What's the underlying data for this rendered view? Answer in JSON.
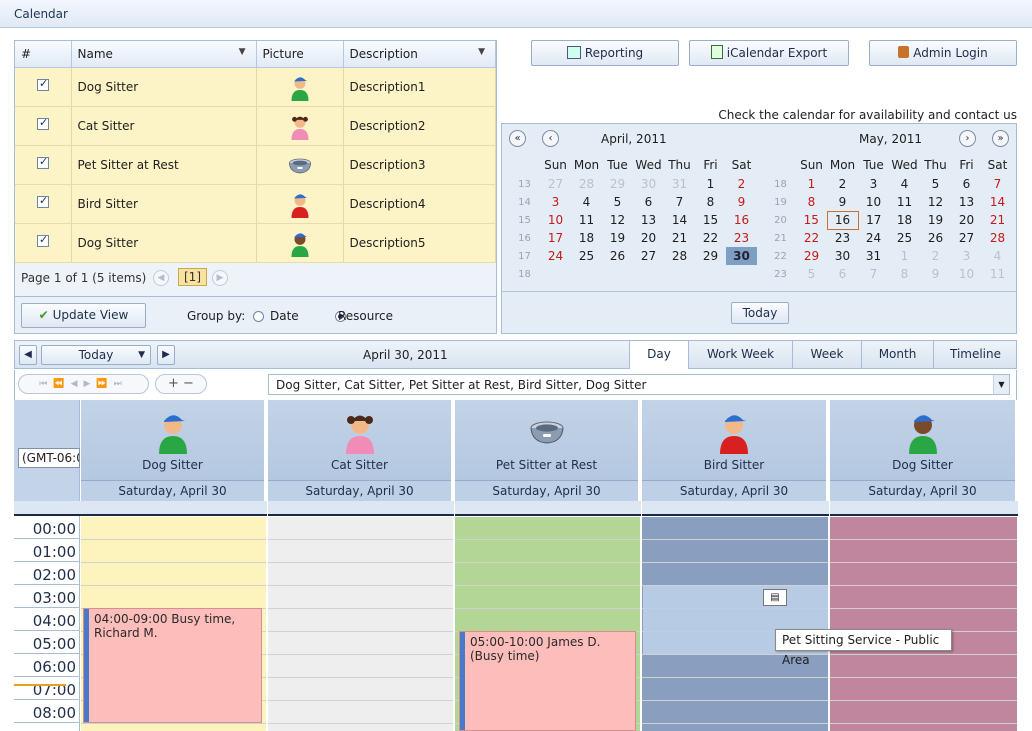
{
  "title": "Calendar",
  "grid": {
    "headers": [
      "#",
      "Name",
      "Picture",
      "Description"
    ],
    "rows": [
      {
        "name": "Dog Sitter",
        "description": "Description1",
        "picture": "person-blue-cap-green-shirt-icon"
      },
      {
        "name": "Cat Sitter",
        "description": "Description2",
        "picture": "person-girl-pink-icon"
      },
      {
        "name": "Pet Sitter at Rest",
        "description": "Description3",
        "picture": "pet-bowl-icon"
      },
      {
        "name": "Bird Sitter",
        "description": "Description4",
        "picture": "person-red-shirt-icon"
      },
      {
        "name": "Dog Sitter",
        "description": "Description5",
        "picture": "person-dark-green-shirt-icon"
      }
    ],
    "pager_text": "Page 1 of 1 (5 items)",
    "page_number": "[1]"
  },
  "update_view_label": "Update View",
  "group_by": {
    "label": "Group by:",
    "options": [
      "Date",
      "Resource"
    ],
    "selected": "Resource"
  },
  "top_buttons": {
    "reporting": "Reporting",
    "icalendar": "iCalendar Export",
    "admin": "Admin Login"
  },
  "availability_note": "Check the calendar for availability and contact us",
  "mini_calendar": {
    "day_names": [
      "Sun",
      "Mon",
      "Tue",
      "Wed",
      "Thu",
      "Fri",
      "Sat"
    ],
    "months": [
      {
        "title": "April, 2011",
        "weeks": [
          {
            "wk": "13",
            "days": [
              "27",
              "28",
              "29",
              "30",
              "31",
              "1",
              "2"
            ]
          },
          {
            "wk": "14",
            "days": [
              "3",
              "4",
              "5",
              "6",
              "7",
              "8",
              "9"
            ]
          },
          {
            "wk": "15",
            "days": [
              "10",
              "11",
              "12",
              "13",
              "14",
              "15",
              "16"
            ]
          },
          {
            "wk": "16",
            "days": [
              "17",
              "18",
              "19",
              "20",
              "21",
              "22",
              "23"
            ]
          },
          {
            "wk": "17",
            "days": [
              "24",
              "25",
              "26",
              "27",
              "28",
              "29",
              "30"
            ]
          },
          {
            "wk": "18",
            "days": [
              "",
              "",
              "",
              "",
              "",
              "",
              ""
            ]
          }
        ]
      },
      {
        "title": "May, 2011",
        "weeks": [
          {
            "wk": "18",
            "days": [
              "1",
              "2",
              "3",
              "4",
              "5",
              "6",
              "7"
            ]
          },
          {
            "wk": "19",
            "days": [
              "8",
              "9",
              "10",
              "11",
              "12",
              "13",
              "14"
            ]
          },
          {
            "wk": "20",
            "days": [
              "15",
              "16",
              "17",
              "18",
              "19",
              "20",
              "21"
            ]
          },
          {
            "wk": "21",
            "days": [
              "22",
              "23",
              "24",
              "25",
              "26",
              "27",
              "28"
            ]
          },
          {
            "wk": "22",
            "days": [
              "29",
              "30",
              "31",
              "1",
              "2",
              "3",
              "4"
            ]
          },
          {
            "wk": "23",
            "days": [
              "5",
              "6",
              "7",
              "8",
              "9",
              "10",
              "11"
            ]
          }
        ]
      }
    ],
    "today_label": "Today"
  },
  "scheduler": {
    "today_dropdown": "Today",
    "current_date": "April 30, 2011",
    "views": [
      "Day",
      "Work Week",
      "Week",
      "Month",
      "Timeline"
    ],
    "active_view": "Day",
    "resource_filter": "Dog Sitter, Cat Sitter, Pet Sitter at Rest, Bird Sitter, Dog Sitter",
    "timezone": "(GMT-06:0",
    "resources": [
      {
        "name": "Dog Sitter",
        "date": "Saturday, April 30"
      },
      {
        "name": "Cat Sitter",
        "date": "Saturday, April 30"
      },
      {
        "name": "Pet Sitter at Rest",
        "date": "Saturday, April 30"
      },
      {
        "name": "Bird Sitter",
        "date": "Saturday, April 30"
      },
      {
        "name": "Dog Sitter",
        "date": "Saturday, April 30"
      }
    ],
    "times": [
      "00:00",
      "01:00",
      "02:00",
      "03:00",
      "04:00",
      "05:00",
      "06:00",
      "07:00",
      "08:00"
    ],
    "appointments": [
      {
        "text": "04:00-09:00 Busy time, Richard M."
      },
      {
        "text": "05:00-10:00 James D. (Busy time)"
      }
    ],
    "tooltip": "Pet Sitting Service - Public Area",
    "colors": {
      "dog_sitter": "#fdf3bd",
      "cat_sitter": "#eeeeee",
      "pet_sitter_rest": "#b3d595",
      "bird_sitter": "#8a9fbf",
      "dog_sitter_2": "#bf869e",
      "appointment": "#fdbdbb"
    }
  }
}
